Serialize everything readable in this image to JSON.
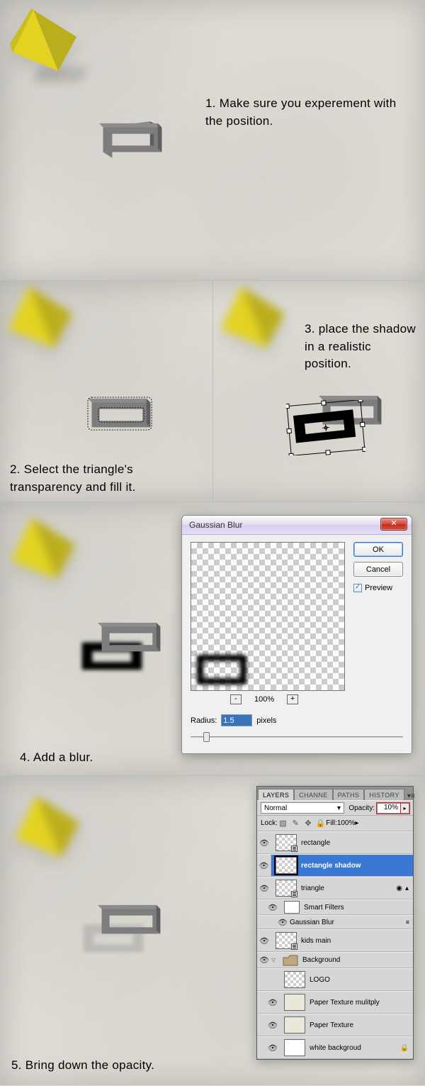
{
  "step1": {
    "caption": "1. Make sure you experement with the position."
  },
  "step2": {
    "caption": "2. Select the triangle's transparency and fill it."
  },
  "step3": {
    "caption": "3. place the shadow in a realistic position."
  },
  "step4": {
    "caption": "4. Add a blur."
  },
  "step5": {
    "caption": "5. Bring down the opacity."
  },
  "dialog": {
    "title": "Gaussian Blur",
    "ok": "OK",
    "cancel": "Cancel",
    "preview_label": "Preview",
    "zoom": "100%",
    "radius_label": "Radius:",
    "radius_value": "1.5",
    "radius_unit": "pixels"
  },
  "layers_panel": {
    "tabs": [
      "LAYERS",
      "CHANNE",
      "PATHS",
      "HISTORY"
    ],
    "blend_mode": "Normal",
    "opacity_label": "Opacity:",
    "opacity_value": "10%",
    "lock_label": "Lock:",
    "fill_label": "Fill:",
    "fill_value": "100%",
    "layers": {
      "rectangle": "rectangle",
      "rectangle_shadow": "rectangle shadow",
      "triangle": "triangle",
      "smart_filters": "Smart Filters",
      "gaussian_blur": "Gaussian Blur",
      "kids_main": "kids main",
      "background_group": "Background",
      "logo": "LOGO",
      "paper_texture_multiply": "Paper Texture mulitply",
      "paper_texture": "Paper Texture",
      "white_background": "white backgroud"
    }
  }
}
